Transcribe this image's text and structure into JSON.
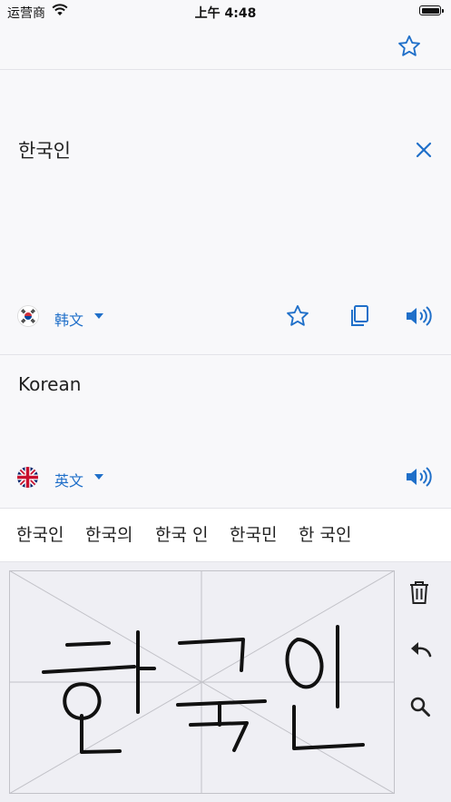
{
  "status_bar": {
    "carrier": "运营商",
    "time": "上午 4:48"
  },
  "source": {
    "text": "한국인",
    "language": "韩文",
    "flag_icon": "south-korea-flag-icon"
  },
  "target": {
    "text": "Korean",
    "language": "英文",
    "flag_icon": "united-kingdom-flag-icon"
  },
  "suggestions": [
    "한국인",
    "한국의",
    "한국 인",
    "한국민",
    "한 국인"
  ],
  "handwriting": {
    "tools": [
      "trash-icon",
      "undo-icon",
      "search-icon"
    ]
  },
  "colors": {
    "accent": "#1f6fc9",
    "background": "#f8f8fa",
    "canvas": "#efeff4"
  }
}
